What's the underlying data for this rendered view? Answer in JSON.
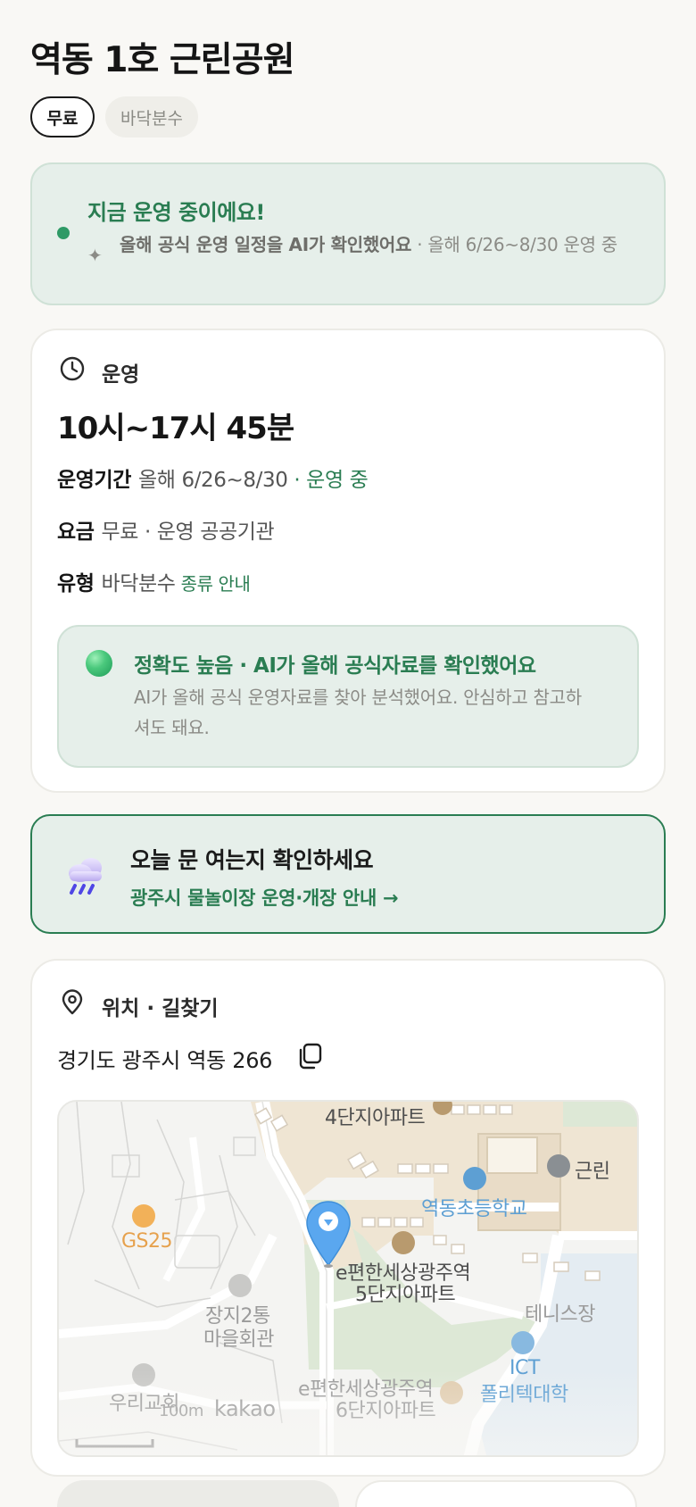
{
  "header": {
    "title": "역동 1호 근린공원",
    "chips": {
      "free": "무료",
      "type": "바닥분수"
    }
  },
  "status": {
    "title": "지금 운영 중이에요!",
    "ai_note": "올해 공식 운영 일정을 AI가 확인했어요",
    "period_note": " · 올해 6/26~8/30 운영 중",
    "dot_color": "#2e9a66"
  },
  "operation": {
    "section_title": "운영",
    "hours": "10시~17시 45분",
    "period_key": "운영기간",
    "period_value": "올해 6/26~8/30",
    "period_status": " · 운영 중",
    "fee_key": "요금",
    "fee_value": "무료 · 운영 공공기관",
    "type_key": "유형",
    "type_value": "바닥분수",
    "type_link": "종류 안내",
    "accuracy": {
      "title": "정확도 높음 · AI가 올해 공식자료를 확인했어요",
      "desc": "AI가 올해 공식 운영자료를 찾아 분석했어요. 안심하고 참고하셔도 돼요."
    }
  },
  "notice": {
    "icon": "rain-cloud-icon",
    "title": "오늘 문 여는지 확인하세요",
    "link": "광주시 물놀이장 운영·개장 안내 →"
  },
  "location": {
    "section_title": "위치 · 길찾기",
    "address": "경기도 광주시 역동 266",
    "map": {
      "labels": {
        "apt4": "4단지아파트",
        "school": "역동초등학교",
        "gs25": "GS25",
        "apt5_line1": "e편한세상광주역",
        "apt5_line2": "5단지아파트",
        "village_line1": "장지2통",
        "village_line2": "마을회관",
        "tennis": "테니스장",
        "ict_line1": "ICT",
        "ict_line2": "폴리텍대학",
        "apt6_line1": "e편한세상광주역",
        "apt6_line2": "6단지아파트",
        "church": "우리교회",
        "partial": "근린",
        "scale": "100m",
        "brand": "kakao"
      }
    }
  },
  "colors": {
    "accent": "#2a7d52",
    "status_bg": "#e6efea",
    "pin": "#5aa7ef"
  }
}
